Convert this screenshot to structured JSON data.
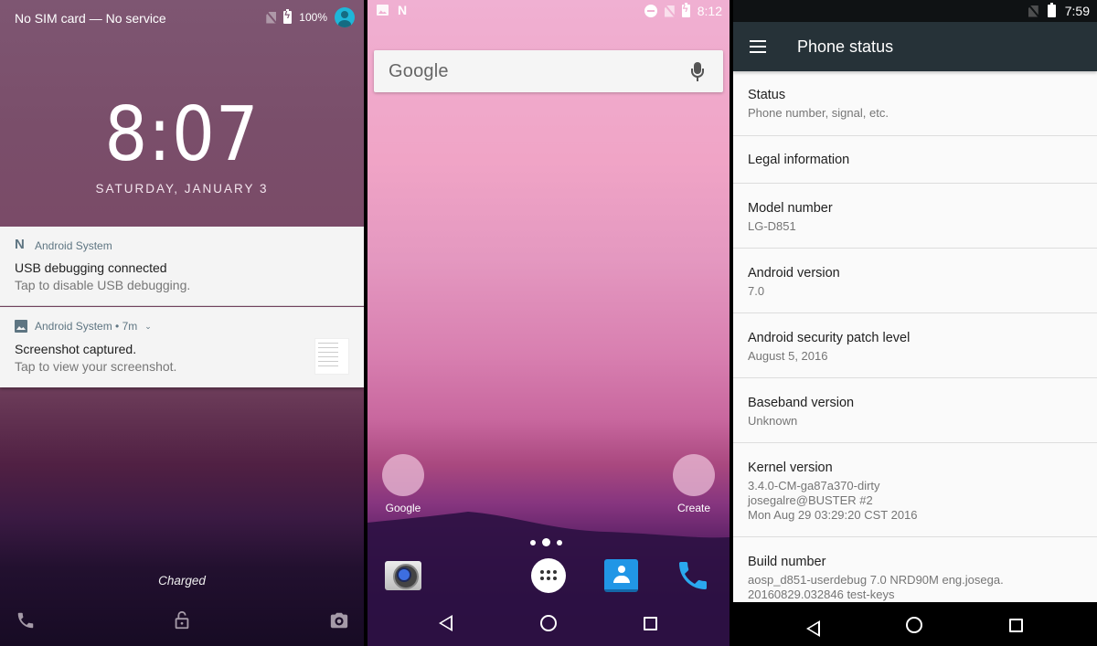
{
  "lock_screen": {
    "status_bar": {
      "carrier_text": "No SIM card — No service",
      "battery_percent": "100%",
      "icons": [
        "no-sim-icon",
        "battery-charging-icon",
        "user-avatar-icon"
      ]
    },
    "clock": "8:07",
    "date": "SATURDAY, JANUARY 3",
    "notifications": [
      {
        "app": "Android System",
        "icon": "android-n-icon",
        "title": "USB debugging connected",
        "text": "Tap to disable USB debugging."
      },
      {
        "app": "Android System • 7m",
        "icon": "image-icon",
        "title": "Screenshot captured.",
        "text": "Tap to view your screenshot."
      }
    ],
    "charge_status": "Charged",
    "shortcuts": [
      "phone-icon",
      "unlock-icon",
      "camera-icon"
    ]
  },
  "home_screen": {
    "status_bar": {
      "time": "8:12",
      "left_icons": [
        "image-icon",
        "android-n-icon"
      ],
      "right_icons": [
        "do-not-disturb-icon",
        "no-sim-icon",
        "battery-charging-icon"
      ]
    },
    "search_bar": {
      "logo_text": "Google",
      "mic_icon": "mic-icon"
    },
    "shortcuts": [
      {
        "label": "Google"
      },
      {
        "label": "Create"
      }
    ],
    "page_indicator": {
      "pages": 3,
      "current": 2
    },
    "dock": [
      "camera-app-icon",
      "app-drawer-icon",
      "contacts-app-icon",
      "phone-app-icon"
    ],
    "nav": [
      "back",
      "home",
      "recents"
    ]
  },
  "settings_screen": {
    "status_bar": {
      "time": "7:59"
    },
    "app_bar": {
      "title": "Phone status",
      "menu_icon": "hamburger-menu-icon"
    },
    "items": [
      {
        "title": "Status",
        "summary": [
          "Phone number, signal, etc."
        ]
      },
      {
        "title": "Legal information",
        "summary": []
      },
      {
        "title": "Model number",
        "summary": [
          "LG-D851"
        ]
      },
      {
        "title": "Android version",
        "summary": [
          "7.0"
        ]
      },
      {
        "title": "Android security patch level",
        "summary": [
          "August 5, 2016"
        ]
      },
      {
        "title": "Baseband version",
        "summary": [
          "Unknown"
        ]
      },
      {
        "title": "Kernel version",
        "summary": [
          "3.4.0-CM-ga87a370-dirty",
          "josegalre@BUSTER #2",
          "Mon Aug 29 03:29:20 CST 2016"
        ]
      },
      {
        "title": "Build number",
        "summary": [
          "aosp_d851-userdebug 7.0 NRD90M eng.josega.",
          "20160829.032846 test-keys"
        ]
      }
    ],
    "nav": [
      "back",
      "home",
      "recents"
    ]
  },
  "colors": {
    "avatar_accent": "#1fb6d8",
    "app_bar": "#263238",
    "phone_app": "#2aa8ee",
    "contacts_app": "#2196e6"
  }
}
